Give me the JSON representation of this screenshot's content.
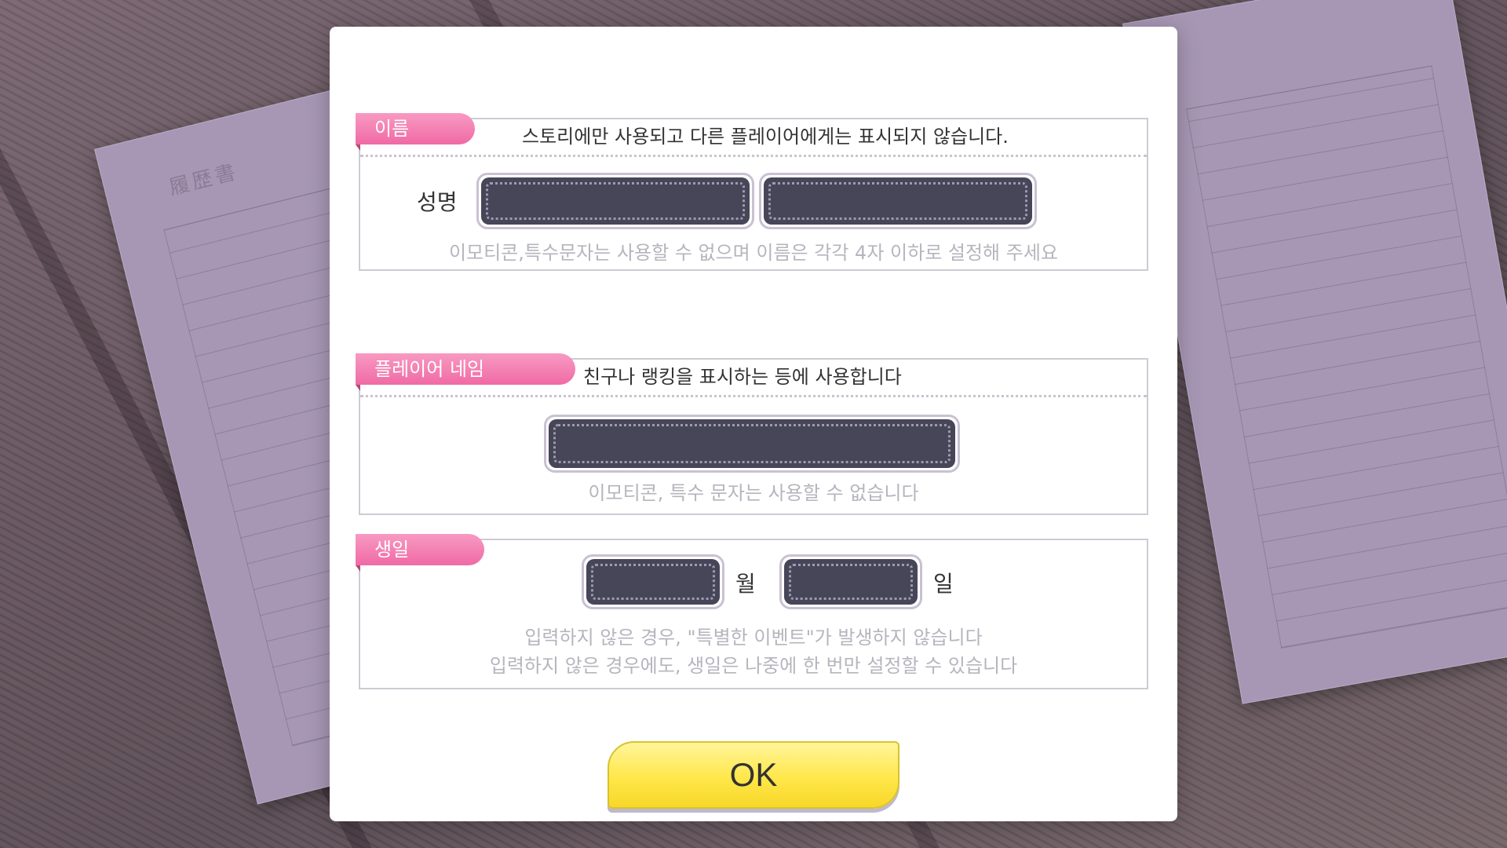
{
  "background": {
    "document_title": "履歴書"
  },
  "name_section": {
    "tab_label": "이름",
    "description": "스토리에만 사용되고 다른 플레이어에게는 표시되지 않습니다.",
    "field_label": "성명",
    "hint": "이모티콘,특수문자는 사용할 수 없으며 이름은 각각 4자 이하로 설정해 주세요",
    "last_name_value": "",
    "first_name_value": ""
  },
  "player_section": {
    "tab_label": "플레이어 네임",
    "description": "친구나 랭킹을 표시하는 등에 사용합니다",
    "hint": "이모티콘, 특수 문자는 사용할 수 없습니다",
    "player_name_value": ""
  },
  "birthday_section": {
    "tab_label": "생일",
    "month_label": "월",
    "day_label": "일",
    "hint_line1": "입력하지 않은 경우, \"특별한 이벤트\"가 발생하지 않습니다",
    "hint_line2": "입력하지 않은 경우에도, 생일은 나중에 한 번만 설정할 수 있습니다",
    "month_value": "",
    "day_value": ""
  },
  "ok_button": {
    "label": "OK"
  },
  "colors": {
    "tab_pink": "#f06aa5",
    "field_dark": "#474558",
    "ok_yellow": "#ffe74a",
    "hint_gray": "#b7b4bd"
  }
}
